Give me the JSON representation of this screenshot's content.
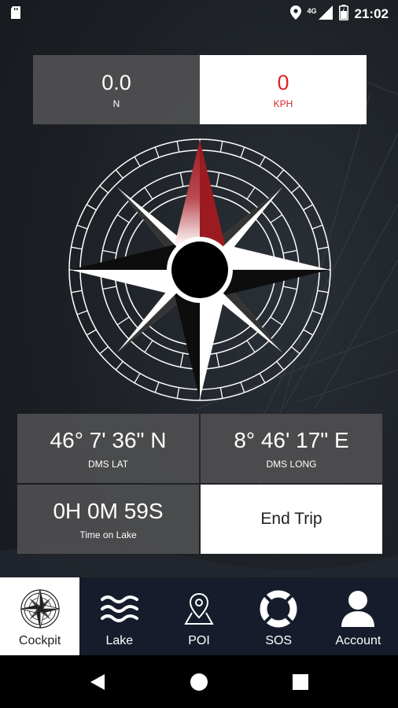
{
  "status_bar": {
    "network": "4G",
    "time": "21:02"
  },
  "speed": {
    "heading_value": "0.0",
    "heading_unit": "N",
    "speed_value": "0",
    "speed_unit": "KPH"
  },
  "position": {
    "latitude": "46° 7' 36\" N",
    "latitude_label": "DMS LAT",
    "longitude": "8° 46' 17\" E",
    "longitude_label": "DMS LONG",
    "duration": "0H 0M 59S",
    "duration_label": "Time on Lake"
  },
  "actions": {
    "end_trip": "End Trip"
  },
  "bottom_nav": [
    {
      "label": "Cockpit",
      "icon": "compass-icon",
      "active": true
    },
    {
      "label": "Lake",
      "icon": "waves-icon",
      "active": false
    },
    {
      "label": "POI",
      "icon": "map-pin-icon",
      "active": false
    },
    {
      "label": "SOS",
      "icon": "lifebuoy-icon",
      "active": false
    },
    {
      "label": "Account",
      "icon": "person-icon",
      "active": false
    }
  ],
  "colors": {
    "speed_accent": "#e0232a",
    "nav_background": "#161c2b",
    "compass_north": "#9b1b20"
  }
}
